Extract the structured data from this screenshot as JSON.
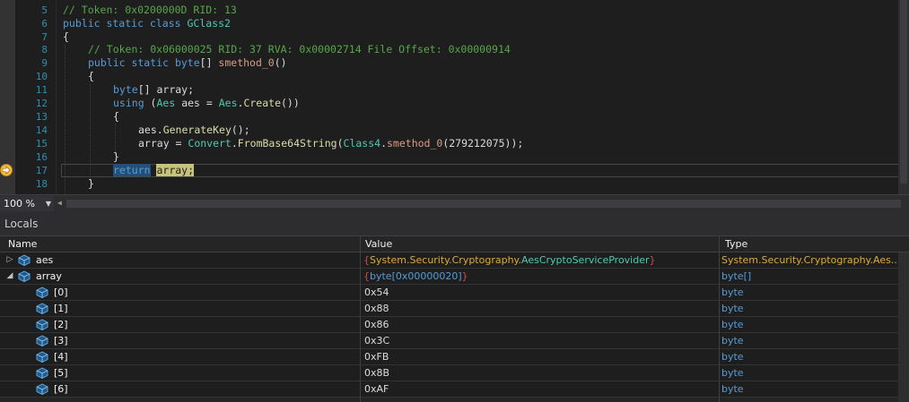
{
  "editor": {
    "line_numbers": [
      "5",
      "6",
      "7",
      "8",
      "9",
      "10",
      "11",
      "12",
      "13",
      "14",
      "15",
      "16",
      "17",
      "18"
    ],
    "code": {
      "l5_comment": "// Token: 0x0200000D RID: 13",
      "l6_kw": "public static class ",
      "l6_type": "GClass2",
      "l7": "{",
      "l8_comment": "// Token: 0x06000025 RID: 37 RVA: 0x00002714 File Offset: 0x00000914",
      "l9_kw1": "public static ",
      "l9_kw2": "byte",
      "l9_p1": "[] ",
      "l9_meth": "smethod_0",
      "l9_p2": "()",
      "l10": "{",
      "l11_kw": "byte",
      "l11_p": "[] array;",
      "l12_kw": "using",
      "l12_p1": " (",
      "l12_t1": "Aes",
      "l12_p2": " aes = ",
      "l12_t2": "Aes",
      "l12_p3": ".",
      "l12_m": "Create",
      "l12_p4": "())",
      "l13": "{",
      "l14_p1": "aes.",
      "l14_m": "GenerateKey",
      "l14_p2": "();",
      "l15_p1": "array = ",
      "l15_t1": "Convert",
      "l15_p2": ".",
      "l15_m": "FromBase64String",
      "l15_p3": "(",
      "l15_t2": "Class4",
      "l15_p4": ".",
      "l15_m2": "smethod_0",
      "l15_p5": "(279212075));",
      "l16": "}",
      "l17_kw": "return",
      "l17_p1": " ",
      "l17_var": "array;",
      "l18": "}"
    }
  },
  "zoom": {
    "level": "100 %"
  },
  "locals": {
    "title": "Locals",
    "columns": {
      "name": "Name",
      "value": "Value",
      "type": "Type"
    },
    "rows": [
      {
        "name": "aes",
        "value_open": "{",
        "value_ns": "System.Security.Cryptography.",
        "value_cls": "AesCryptoServiceProvider",
        "value_close": "}",
        "type": "System.Security.Cryptography.Aes...",
        "expander": "▷"
      },
      {
        "name": "array",
        "value_open": "{",
        "value_ns": "byte[0x00000020]",
        "value_cls": "",
        "value_close": "}",
        "type": "byte[]",
        "expander": "◢"
      },
      {
        "name": "[0]",
        "value": "0x54",
        "type": "byte"
      },
      {
        "name": "[1]",
        "value": "0x88",
        "type": "byte"
      },
      {
        "name": "[2]",
        "value": "0x86",
        "type": "byte"
      },
      {
        "name": "[3]",
        "value": "0x3C",
        "type": "byte"
      },
      {
        "name": "[4]",
        "value": "0xFB",
        "type": "byte"
      },
      {
        "name": "[5]",
        "value": "0x8B",
        "type": "byte"
      },
      {
        "name": "[6]",
        "value": "0xAF",
        "type": "byte"
      }
    ]
  },
  "colors": {
    "background": "#1e1e1e",
    "comment": "#57a64a",
    "keyword": "#569cd6",
    "type": "#4ec9b0",
    "method": "#dcdcaa",
    "line_number": "#2b91af",
    "breakpoint_arrow": "#f0c040"
  },
  "icons": {
    "current_statement": "execution-arrow-icon",
    "local_variable": "cube-icon",
    "zoom_dropdown": "chevron-down-icon"
  }
}
